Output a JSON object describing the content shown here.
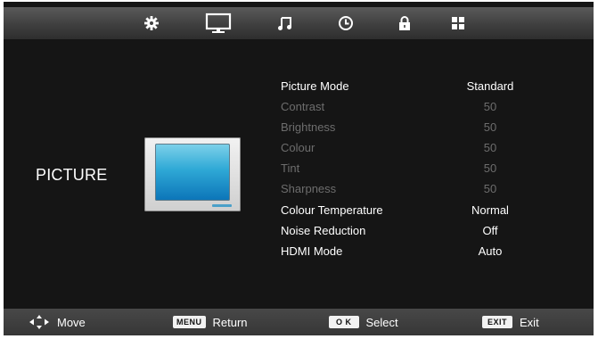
{
  "tabs": [
    {
      "icon": "gear-icon"
    },
    {
      "icon": "monitor-icon",
      "selected": true
    },
    {
      "icon": "music-note-icon"
    },
    {
      "icon": "clock-icon"
    },
    {
      "icon": "lock-icon"
    },
    {
      "icon": "grid-icon"
    }
  ],
  "section": {
    "title": "PICTURE"
  },
  "menu": {
    "picture_mode": {
      "label": "Picture Mode",
      "value": "Standard"
    },
    "contrast": {
      "label": "Contrast",
      "value": "50"
    },
    "brightness": {
      "label": "Brightness",
      "value": "50"
    },
    "colour": {
      "label": "Colour",
      "value": "50"
    },
    "tint": {
      "label": "Tint",
      "value": "50"
    },
    "sharpness": {
      "label": "Sharpness",
      "value": "50"
    },
    "colour_temperature": {
      "label": "Colour Temperature",
      "value": "Normal"
    },
    "noise_reduction": {
      "label": "Noise Reduction",
      "value": "Off"
    },
    "hdmi_mode": {
      "label": "HDMI Mode",
      "value": "Auto"
    }
  },
  "footer": {
    "move": {
      "text": "Move"
    },
    "menu": {
      "key": "MENU",
      "text": "Return"
    },
    "ok": {
      "key": "O K",
      "text": "Select"
    },
    "exit": {
      "key": "EXIT",
      "text": "Exit"
    }
  },
  "colors": {
    "active_text": "#ffffff",
    "dimmed_text": "#6d6d6d",
    "background": "#151515"
  }
}
